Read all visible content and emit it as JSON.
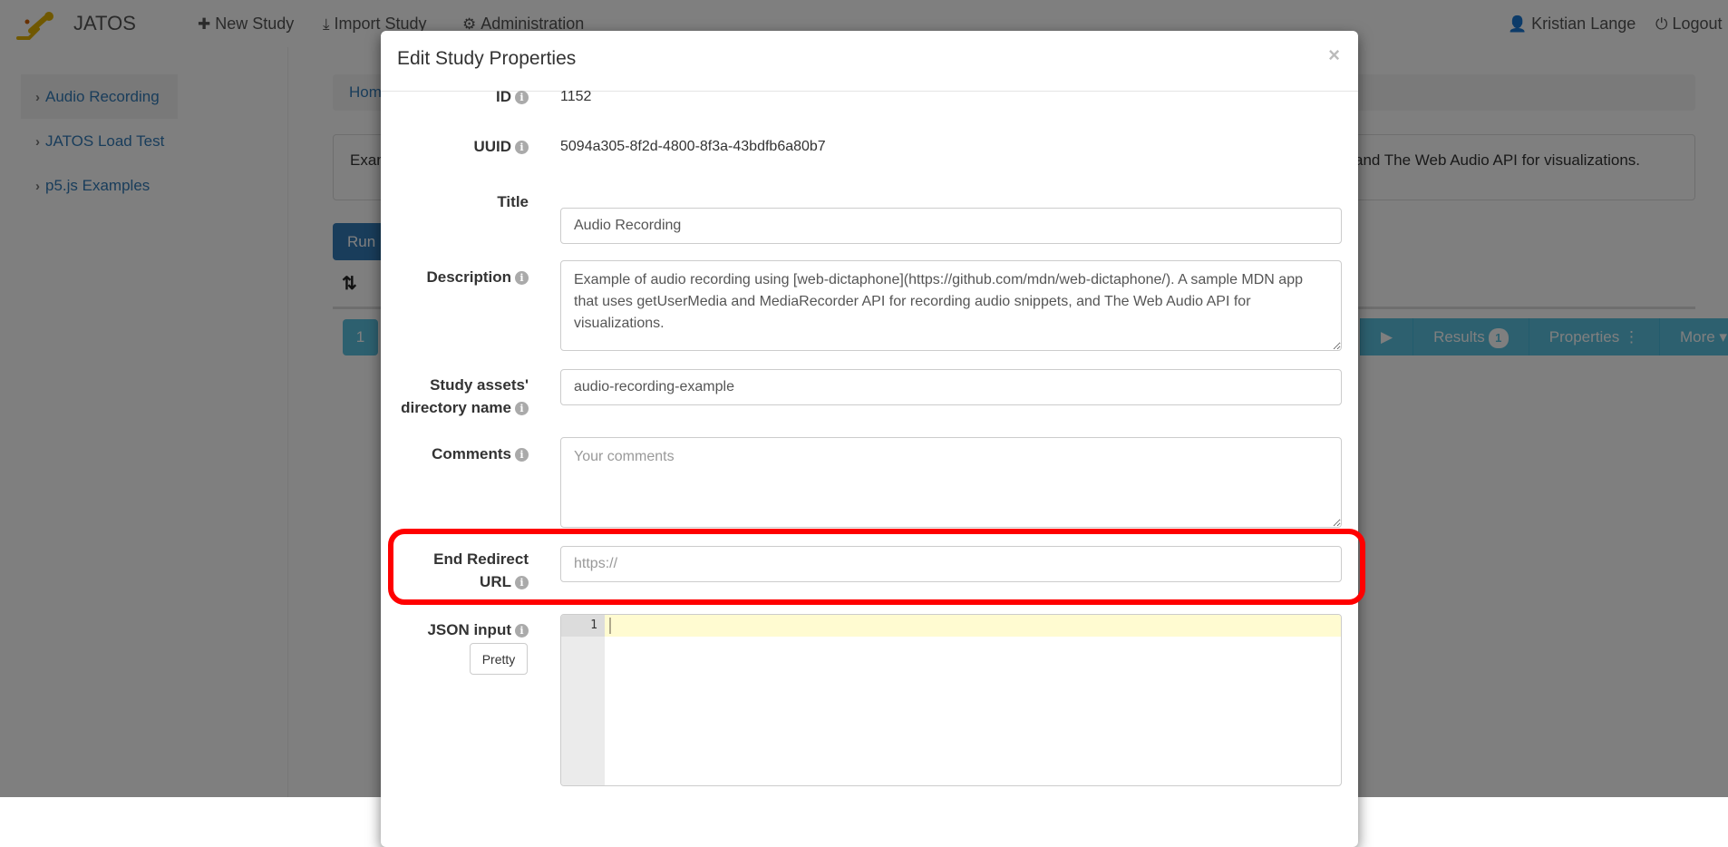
{
  "navbar": {
    "brand": "JATOS",
    "links": [
      {
        "icon": "plus-icon",
        "label": "New Study"
      },
      {
        "icon": "import-icon",
        "label": "Import Study"
      },
      {
        "icon": "gear-icon",
        "label": "Administration"
      }
    ],
    "user": {
      "icon": "user-icon",
      "label": "Kristian Lange"
    },
    "logout": {
      "icon": "power-icon",
      "label": "Logout"
    }
  },
  "sidebar": {
    "items": [
      {
        "label": "Audio Recording",
        "active": true
      },
      {
        "label": "JATOS Load Test",
        "active": false
      },
      {
        "label": "p5.js Examples",
        "active": false
      }
    ]
  },
  "main": {
    "breadcrumb": "Home",
    "description_left": "Exam",
    "description_right": "and The Web Audio API for visualizations.",
    "run_button": "Run",
    "component_position": "1",
    "component_actions": [
      {
        "name": "run",
        "label": "▶"
      },
      {
        "name": "results",
        "label": "Results",
        "badge": "1"
      },
      {
        "name": "properties",
        "label": "Properties ⋮"
      },
      {
        "name": "more",
        "label": "More ▾"
      }
    ]
  },
  "modal": {
    "title": "Edit Study Properties",
    "close_label": "×",
    "fields": {
      "id": {
        "label": "ID",
        "value": "1152"
      },
      "uuid": {
        "label": "UUID",
        "value": "5094a305-8f2d-4800-8f3a-43bdfb6a80b7"
      },
      "title": {
        "label": "Title",
        "value": "Audio Recording"
      },
      "description": {
        "label": "Description",
        "value": "Example of audio recording using [web-dictaphone](https://github.com/mdn/web-dictaphone/). A sample MDN app that uses getUserMedia and MediaRecorder API for recording audio snippets, and The Web Audio API for visualizations."
      },
      "dir_name": {
        "label_line1": "Study assets'",
        "label_line2": "directory name",
        "value": "audio-recording-example"
      },
      "comments": {
        "label": "Comments",
        "value": "",
        "placeholder": "Your comments"
      },
      "end_redirect_url": {
        "label_line1": "End Redirect",
        "label_line2": "URL",
        "value": "",
        "placeholder": "https://"
      },
      "json_input": {
        "label": "JSON input",
        "pretty_button": "Pretty",
        "line_numbers": [
          "1"
        ],
        "value": ""
      }
    },
    "highlight_color": "#ff0000"
  }
}
